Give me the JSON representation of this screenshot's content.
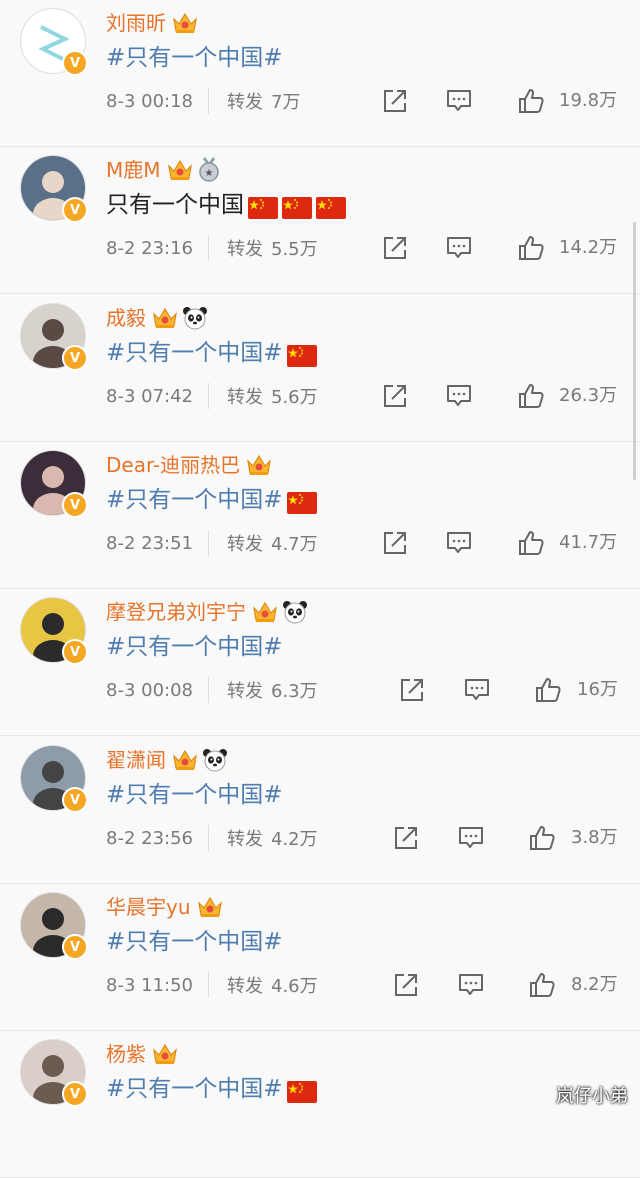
{
  "colors": {
    "name": "#e8742a",
    "hashtag": "#507daf",
    "meta": "#7a7a7a",
    "badge": "#f5a623",
    "flag_red": "#de2910",
    "flag_yellow": "#ffde00"
  },
  "labels": {
    "repost": "转发"
  },
  "icons": {
    "share": "share-icon",
    "comment": "comment-icon",
    "like": "thumbs-up-icon",
    "crown": "crown-icon",
    "panda": "panda-icon",
    "medal": "medal-icon",
    "verified": "verified-v-badge"
  },
  "verified_mark": "V",
  "watermark": "岚仔小弟",
  "posts": [
    {
      "name": "刘雨昕",
      "badges": [
        "crown"
      ],
      "text": "#只有一个中国#",
      "hashtag": true,
      "flags": 0,
      "time": "8-3 00:18",
      "reposts": "7万",
      "likes": "19.8万"
    },
    {
      "name": "M鹿M",
      "badges": [
        "crown",
        "medal"
      ],
      "text": "只有一个中国",
      "hashtag": false,
      "flags": 3,
      "time": "8-2 23:16",
      "reposts": "5.5万",
      "likes": "14.2万"
    },
    {
      "name": "成毅",
      "badges": [
        "crown",
        "panda"
      ],
      "text": "#只有一个中国#",
      "hashtag": true,
      "flags": 1,
      "time": "8-3 07:42",
      "reposts": "5.6万",
      "likes": "26.3万"
    },
    {
      "name": "Dear-迪丽热巴",
      "badges": [
        "crown"
      ],
      "text": "#只有一个中国# ",
      "hashtag": true,
      "flags": 1,
      "time": "8-2 23:51",
      "reposts": "4.7万",
      "likes": "41.7万"
    },
    {
      "name": "摩登兄弟刘宇宁",
      "badges": [
        "crown",
        "panda"
      ],
      "text": "#只有一个中国#",
      "hashtag": true,
      "flags": 0,
      "time": "8-3 00:08",
      "reposts": "6.3万",
      "likes": "16万"
    },
    {
      "name": "翟潇闻",
      "badges": [
        "crown",
        "panda"
      ],
      "text": "#只有一个中国#",
      "hashtag": true,
      "flags": 0,
      "time": "8-2 23:56",
      "reposts": "4.2万",
      "likes": "3.8万"
    },
    {
      "name": "华晨宇yu",
      "badges": [
        "crown"
      ],
      "text": "#只有一个中国#",
      "hashtag": true,
      "flags": 0,
      "time": "8-3 11:50",
      "reposts": "4.6万",
      "likes": "8.2万"
    },
    {
      "name": "杨紫",
      "badges": [
        "crown"
      ],
      "text": "#只有一个中国#",
      "hashtag": true,
      "flags": 1,
      "time": "",
      "reposts": "",
      "likes": ""
    }
  ]
}
